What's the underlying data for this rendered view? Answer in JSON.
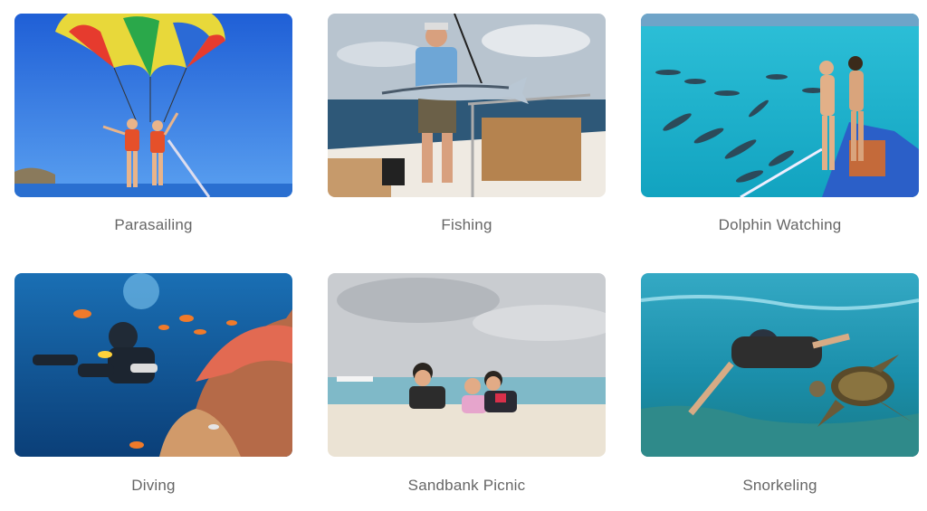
{
  "activities": [
    {
      "label": "Parasailing",
      "icon": "parasailing-photo"
    },
    {
      "label": "Fishing",
      "icon": "fishing-photo"
    },
    {
      "label": "Dolphin Watching",
      "icon": "dolphin-watching-photo"
    },
    {
      "label": "Diving",
      "icon": "diving-photo"
    },
    {
      "label": "Sandbank Picnic",
      "icon": "sandbank-picnic-photo"
    },
    {
      "label": "Snorkeling",
      "icon": "snorkeling-photo"
    }
  ],
  "colors": {
    "caption": "#666666",
    "sea": "#1ba6c9",
    "sky": "#2f7fe0"
  }
}
